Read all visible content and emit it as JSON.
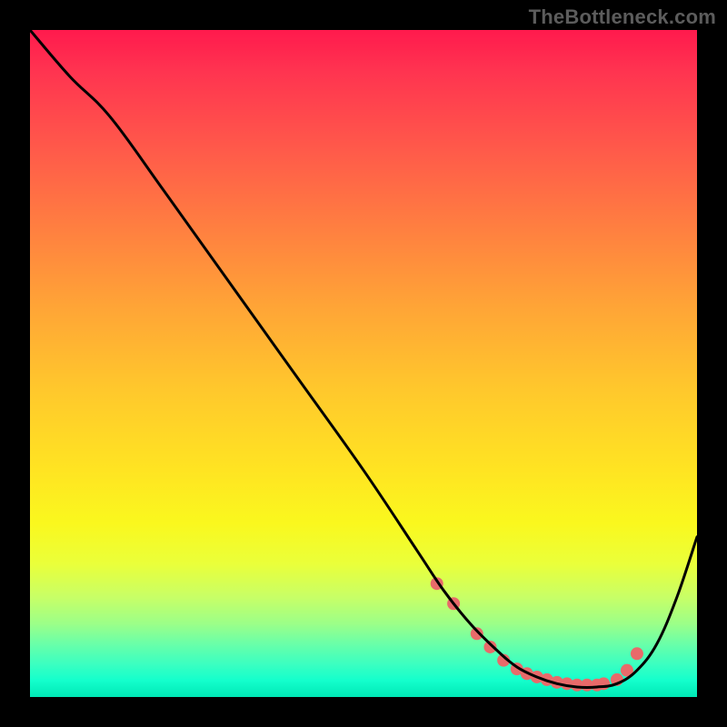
{
  "watermark": "TheBottleneck.com",
  "chart_data": {
    "type": "line",
    "title": "",
    "xlabel": "",
    "ylabel": "",
    "xlim": [
      0,
      100
    ],
    "ylim": [
      0,
      100
    ],
    "series": [
      {
        "name": "curve",
        "x": [
          0,
          6,
          12,
          20,
          30,
          40,
          50,
          58,
          62,
          66,
          70,
          73,
          76,
          79,
          82,
          85,
          88,
          91,
          94,
          97,
          100
        ],
        "y": [
          100,
          93,
          87,
          76,
          62,
          48,
          34,
          22,
          16,
          11,
          7,
          4.5,
          3,
          2,
          1.5,
          1.5,
          2,
          4,
          8,
          15,
          24
        ]
      }
    ],
    "dots": {
      "name": "markers",
      "x": [
        61,
        63.5,
        67,
        69,
        71,
        73,
        74.5,
        76,
        77.5,
        79,
        80.5,
        82,
        83.5,
        85,
        86,
        88,
        89.5,
        91
      ],
      "y": [
        17,
        14,
        9.5,
        7.5,
        5.5,
        4.2,
        3.5,
        3,
        2.6,
        2.2,
        2,
        1.8,
        1.8,
        1.8,
        2,
        2.6,
        4,
        6.5
      ],
      "color": "#e86a6a",
      "radius": 7
    },
    "colors": {
      "curve": "#000000",
      "background_top": "#ff1a4d",
      "background_bottom": "#00e8b6"
    }
  }
}
